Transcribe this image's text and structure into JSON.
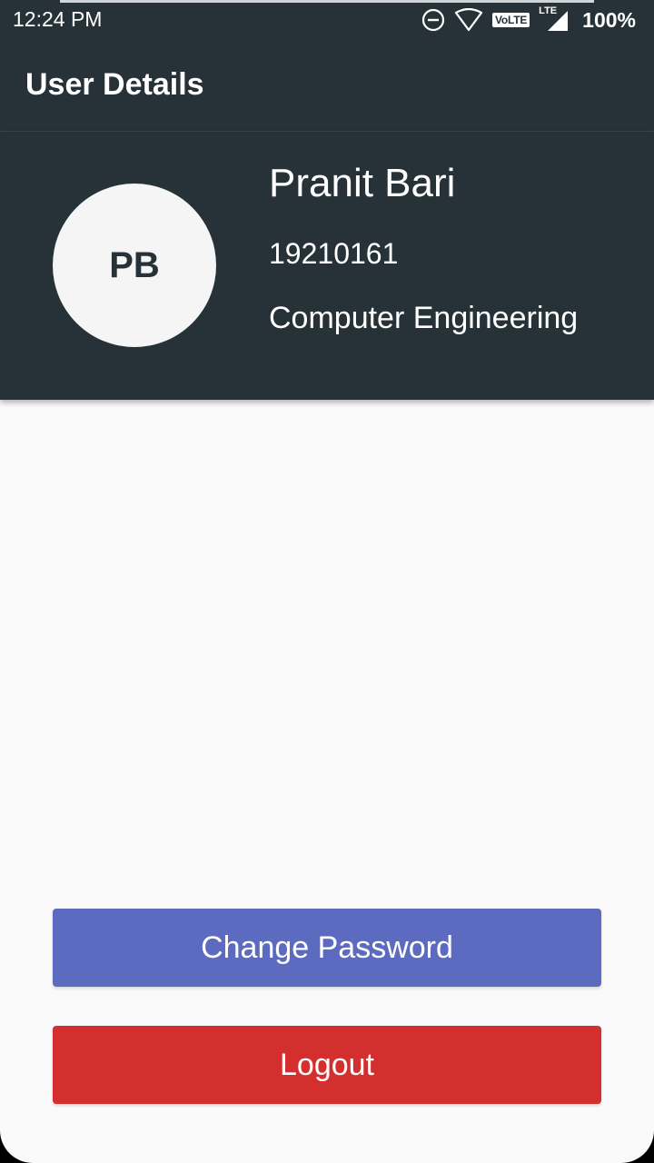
{
  "status_bar": {
    "time": "12:24 PM",
    "volte": "VoLTE",
    "lte": "LTE",
    "battery": "100%",
    "icons": [
      "dnd-icon",
      "wifi-icon",
      "volte-icon",
      "signal-icon"
    ]
  },
  "app_bar": {
    "title": "User Details"
  },
  "profile": {
    "initials": "PB",
    "name": "Pranit Bari",
    "id": "19210161",
    "department": "Computer Engineering"
  },
  "actions": {
    "change_password": "Change Password",
    "logout": "Logout"
  },
  "colors": {
    "primary_dark": "#263238",
    "change_password": "#5c6bc0",
    "logout": "#d32f2f",
    "background": "#fafafa"
  }
}
